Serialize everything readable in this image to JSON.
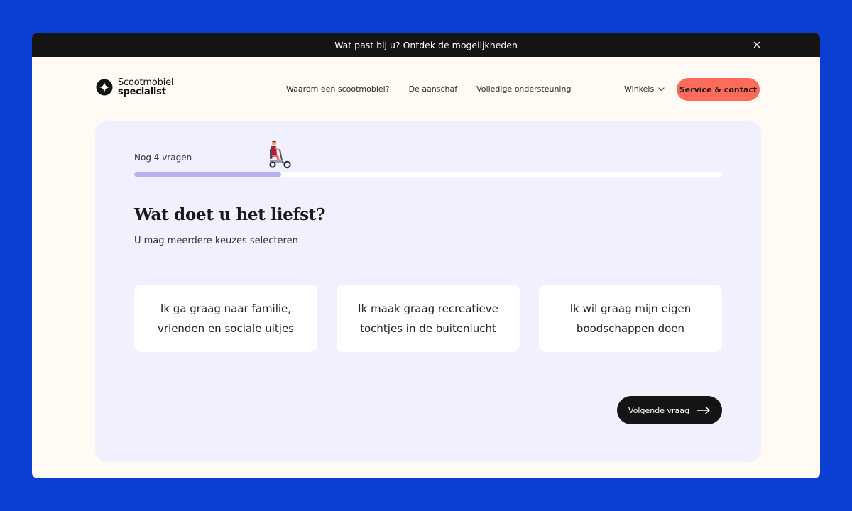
{
  "banner": {
    "lead": "Wat past bij u?",
    "link": "Ontdek de mogelijkheden",
    "close_icon": "close-icon"
  },
  "header": {
    "logo_line1": "Scootmobiel",
    "logo_line2": "specialist",
    "nav": [
      "Waarom een scootmobiel?",
      "De aanschaf",
      "Volledige ondersteuning"
    ],
    "winkels": "Winkels",
    "cta": "Service & contact",
    "cta_color": "#ff6b5b"
  },
  "quiz": {
    "progress_label": "Nog 4 vragen",
    "progress_fraction": 0.25,
    "question": "Wat doet u het liefst?",
    "hint": "U mag meerdere keuzes selecteren",
    "options": [
      {
        "line1": "Ik ga graag naar familie,",
        "line2": "vrienden en sociale uitjes"
      },
      {
        "line1": "Ik maak graag recreatieve",
        "line2": "tochtjes in de buitenlucht"
      },
      {
        "line1": "Ik wil graag mijn eigen",
        "line2": "boodschappen doen"
      }
    ],
    "next": "Volgende vraag",
    "next_icon": "arrow-right-icon"
  },
  "colors": {
    "background": "#0a3fd1",
    "page": "#fffaf4",
    "quiz_panel": "#f1f0ff",
    "progress_fill": "#b9b0ee",
    "dark": "#141414"
  }
}
